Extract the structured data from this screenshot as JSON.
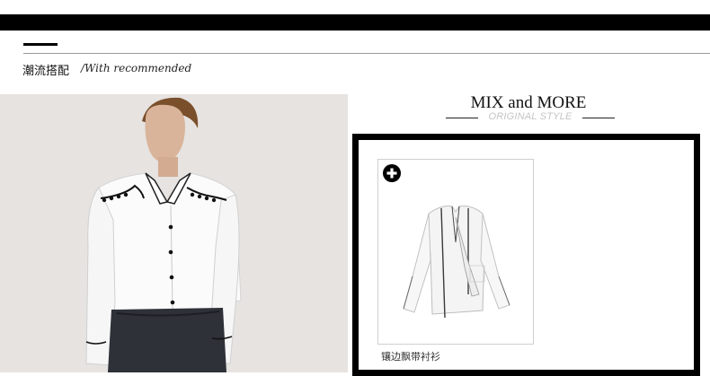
{
  "section": {
    "title": "潮流搭配",
    "subtitle": "/With recommended"
  },
  "mix": {
    "title": "MIX and MORE",
    "subtitle": "ORIGINAL STYLE"
  },
  "products": [
    {
      "name": "镶边飘带衬衫",
      "icon": "plus-circle-icon"
    }
  ],
  "colors": {
    "bar": "#000000",
    "photo_bg": "#e6e3e0",
    "subtitle_gray": "#c4c4c4"
  }
}
